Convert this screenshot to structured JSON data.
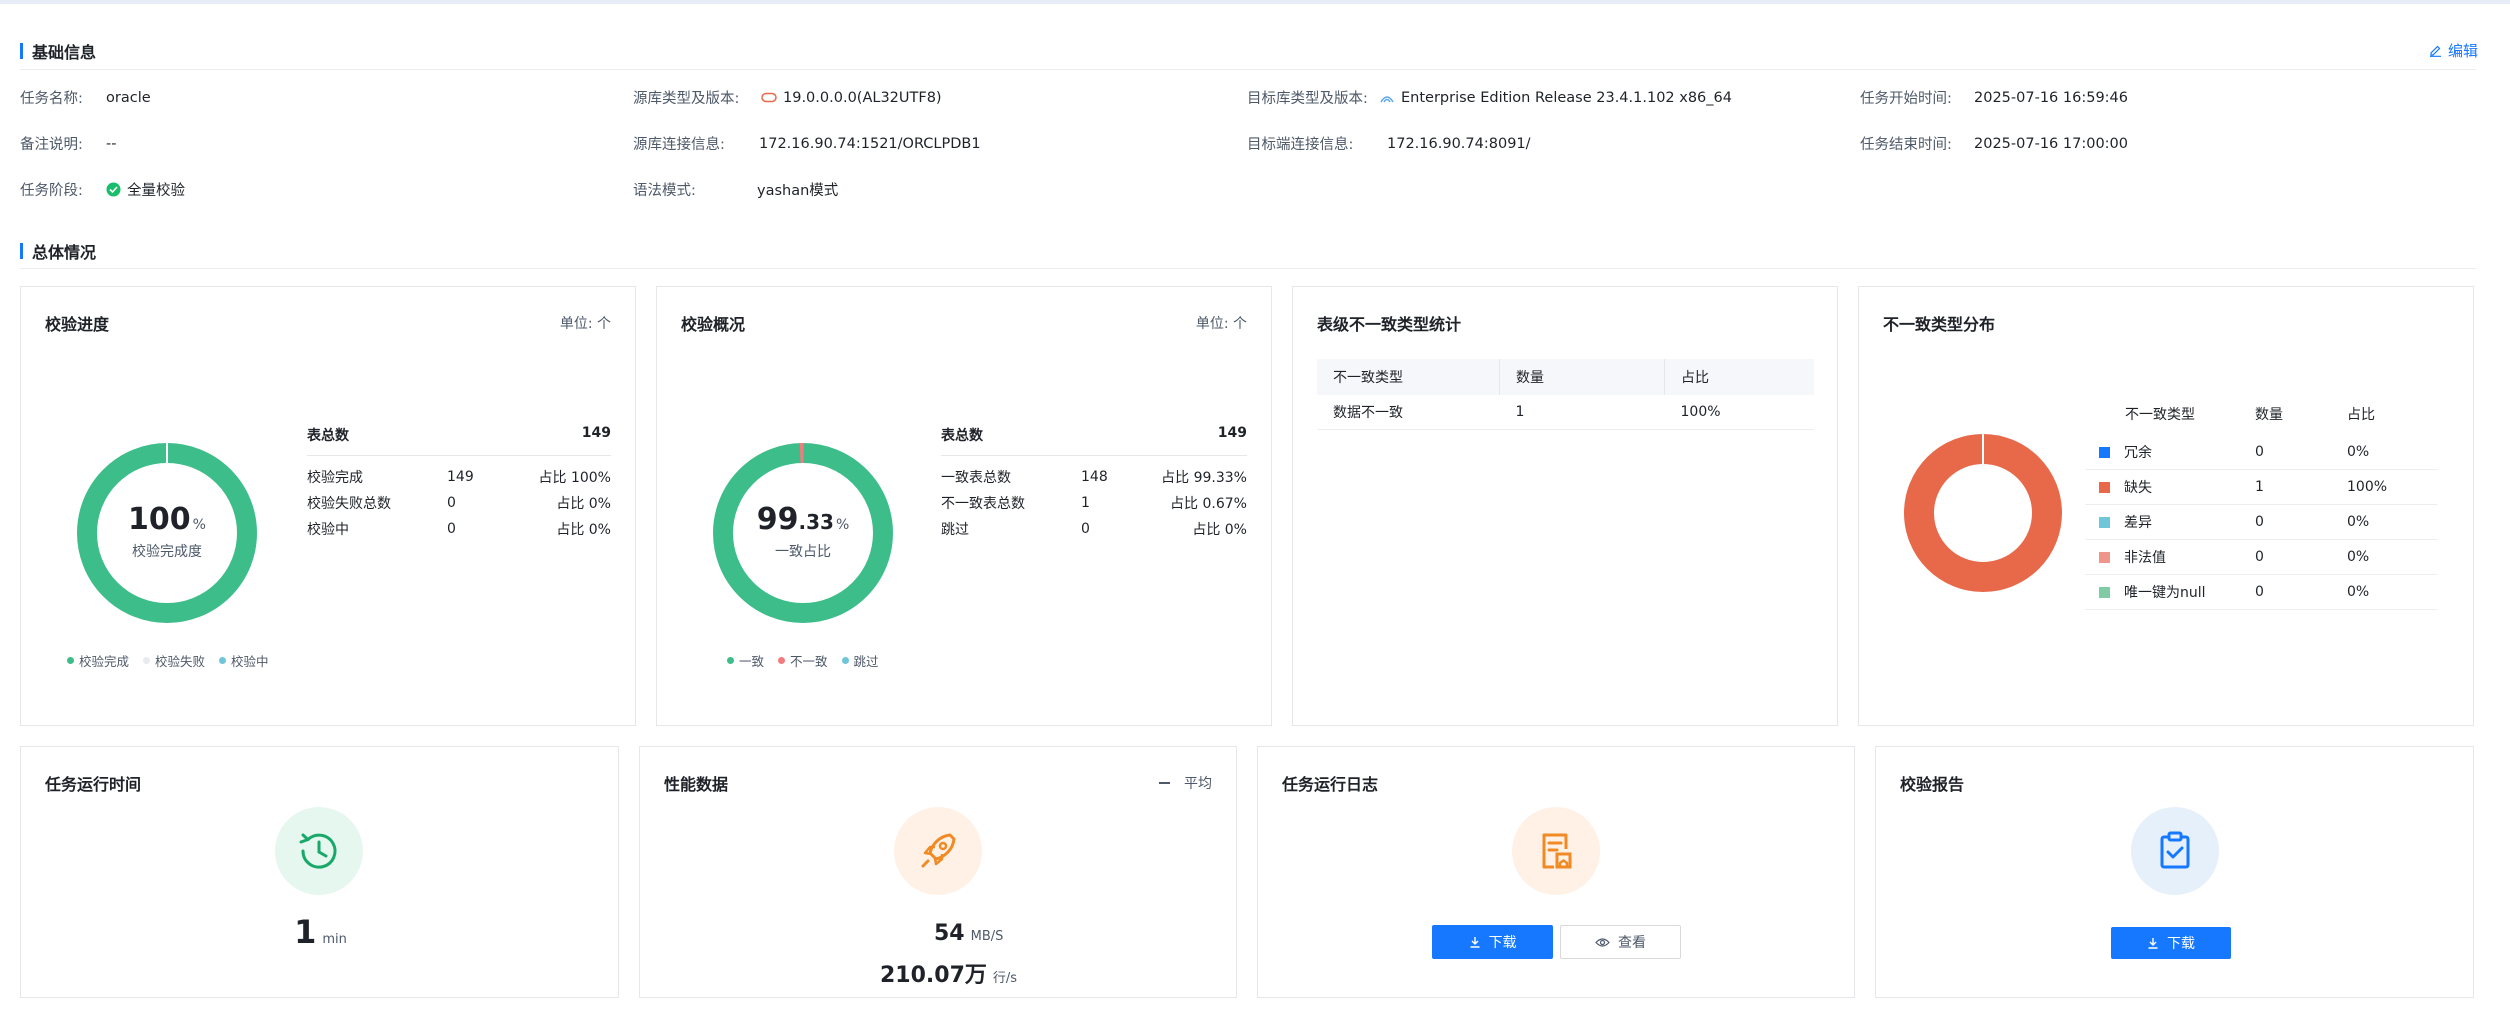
{
  "basic": {
    "title": "基础信息",
    "edit_label": "编辑",
    "task_name_label": "任务名称:",
    "task_name": "oracle",
    "note_label": "备注说明:",
    "note": "--",
    "stage_label": "任务阶段:",
    "stage": "全量校验",
    "source_type_label": "源库类型及版本:",
    "source_type": "19.0.0.0.0(AL32UTF8)",
    "source_conn_label": "源库连接信息:",
    "source_conn": "172.16.90.74:1521/ORCLPDB1",
    "syntax_label": "语法模式:",
    "syntax": "yashan模式",
    "target_type_label": "目标库类型及版本:",
    "target_type": "Enterprise Edition Release 23.4.1.102 x86_64",
    "target_conn_label": "目标端连接信息:",
    "target_conn": "172.16.90.74:8091/",
    "start_label": "任务开始时间:",
    "start": "2025-07-16 16:59:46",
    "end_label": "任务结束时间:",
    "end": "2025-07-16 17:00:00"
  },
  "overall": {
    "title": "总体情况"
  },
  "progress": {
    "title": "校验进度",
    "unit": "单位: 个",
    "center_value": "100",
    "center_unit": "%",
    "center_label": "校验完成度",
    "total_label": "表总数",
    "total": "149",
    "rows": [
      {
        "name": "校验完成",
        "count": "149",
        "ratio": "占比 100%"
      },
      {
        "name": "校验失败总数",
        "count": "0",
        "ratio": "占比 0%"
      },
      {
        "name": "校验中",
        "count": "0",
        "ratio": "占比 0%"
      }
    ],
    "legend": [
      "校验完成",
      "校验失败",
      "校验中"
    ],
    "colors": [
      "#3dbd8a",
      "#e8eaee",
      "#6ec6d8"
    ]
  },
  "overview": {
    "title": "校验概况",
    "unit": "单位: 个",
    "center_int": "99",
    "center_dec": ".33",
    "center_unit": "%",
    "center_label": "一致占比",
    "total_label": "表总数",
    "total": "149",
    "rows": [
      {
        "name": "一致表总数",
        "count": "148",
        "ratio": "占比 99.33%"
      },
      {
        "name": "不一致表总数",
        "count": "1",
        "ratio": "占比 0.67%"
      },
      {
        "name": "跳过",
        "count": "0",
        "ratio": "占比 0%"
      }
    ],
    "legend": [
      "一致",
      "不一致",
      "跳过"
    ],
    "colors": [
      "#3dbd8a",
      "#f07c7c",
      "#6ec6d8"
    ]
  },
  "table_stats": {
    "title": "表级不一致类型统计",
    "headers": [
      "不一致类型",
      "数量",
      "占比"
    ],
    "rows": [
      {
        "type": "数据不一致",
        "count": "1",
        "ratio": "100%"
      }
    ]
  },
  "distribution": {
    "title": "不一致类型分布",
    "headers": [
      "不一致类型",
      "数量",
      "占比"
    ],
    "rows": [
      {
        "type": "冗余",
        "count": "0",
        "ratio": "0%",
        "color": "#1677ff"
      },
      {
        "type": "缺失",
        "count": "1",
        "ratio": "100%",
        "color": "#e8694a"
      },
      {
        "type": "差异",
        "count": "0",
        "ratio": "0%",
        "color": "#6ec6d8"
      },
      {
        "type": "非法值",
        "count": "0",
        "ratio": "0%",
        "color": "#f0958a"
      },
      {
        "type": "唯一键为null",
        "count": "0",
        "ratio": "0%",
        "color": "#7fcba4"
      }
    ]
  },
  "runtime": {
    "title": "任务运行时间",
    "value": "1",
    "unit": "min"
  },
  "perf": {
    "title": "性能数据",
    "avg_label": "平均",
    "speed": "54",
    "speed_unit": "MB/S",
    "rows": "210.07万",
    "rows_unit": "行/s"
  },
  "log": {
    "title": "任务运行日志",
    "download": "下载",
    "view": "查看"
  },
  "report": {
    "title": "校验报告",
    "download": "下载"
  }
}
